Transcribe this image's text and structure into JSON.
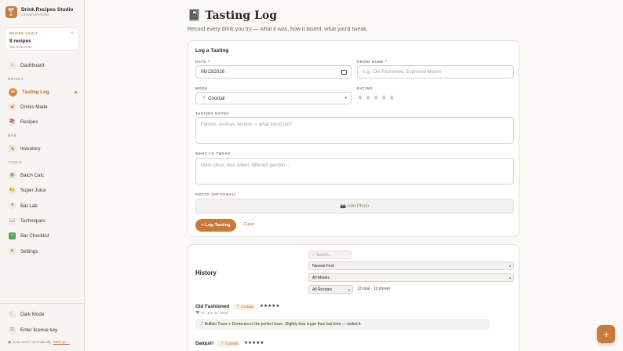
{
  "sidebar": {
    "brand_name": "Drink Recipes Studio",
    "brand_email": "contamp8.studio",
    "vault": {
      "label": "RECIPE VAULT",
      "count": "8 recipes",
      "hint": "Tap to browse"
    },
    "dashboard": "Dashboard",
    "sections": {
      "drinks": "DRINKS",
      "bar": "BAR",
      "tools": "TOOLS"
    },
    "items": {
      "tasting_log": "Tasting Log",
      "drinks_made": "Drinks Made",
      "recipes": "Recipes",
      "inventory": "Inventory",
      "batch_calc": "Batch Calc",
      "super_juice": "Super Juice",
      "bar_lab": "Bar Lab",
      "techniques": "Techniques",
      "bar_checklist": "Bar Checklist",
      "settings": "Settings"
    },
    "dark_mode": "Dark Mode",
    "license": "Enter license key",
    "foot_note": "Data saves automatically.",
    "foot_link": "Back up ..."
  },
  "page": {
    "title": "Tasting Log",
    "subtitle": "Record every drink you try — what it was, how it tasted, what you'd tweak."
  },
  "form": {
    "title": "Log a Tasting",
    "date_label": "DATE *",
    "date_value": "06/13/2026",
    "drink_label": "DRINK NAME *",
    "drink_placeholder": "e.g., Old Fashioned, Espresso Martini",
    "mode_label": "MODE",
    "mode_value": "🍸 Cocktail",
    "rating_label": "RATING",
    "rating_stars": "★★★★★",
    "notes_label": "TASTING NOTES",
    "notes_placeholder": "Flavors, aromas, texture — what stood out?",
    "tweak_label": "WHAT I'D TWEAK",
    "tweak_placeholder": "More citrus, less sweet, different garnish...",
    "photo_label": "PHOTO (OPTIONAL)",
    "photo_button": "📷 Add Photo",
    "submit": "+ Log Tasting",
    "clear": "Clear"
  },
  "history": {
    "title": "History",
    "search_placeholder": "Search...",
    "sort": "Newest First",
    "modes": "All Modes",
    "recipes": "All Recipes",
    "total": "12 total · 12 shown",
    "entries": [
      {
        "name": "Old Fashioned",
        "mode": "🍸 Cocktail",
        "stars": "★★★★★",
        "date": "📅 Fri, Jun 12, 2026",
        "note": "📝 Buffalo Trace + Demerara is the perfect base. Slightly less sugar than last time — nailed it."
      },
      {
        "name": "Daiquiri",
        "mode": "🍸 Cocktail",
        "stars": "★★★★★"
      }
    ]
  },
  "fab": "+",
  "colors": {
    "accent": "#c9793a",
    "accent_text": "#c26a2a",
    "background": "#faf9f6"
  }
}
